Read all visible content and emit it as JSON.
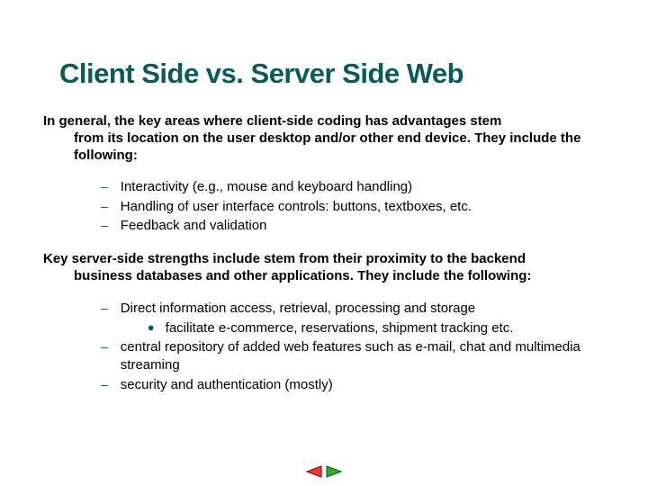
{
  "title": "Client Side vs. Server Side Web",
  "intro1_line1": "In general, the key areas where client-side coding has advantages stem",
  "intro1_rest": "from its location on the user desktop and/or other end device. They include the following:",
  "client_bullets": [
    "Interactivity (e.g., mouse and keyboard handling)",
    "Handling of user interface controls: buttons, textboxes, etc.",
    "Feedback and validation"
  ],
  "intro2_line1": "Key server-side strengths include stem from their proximity to the backend",
  "intro2_rest": "business databases and other applications. They include the following:",
  "server_bullets": [
    {
      "text": "Direct information access, retrieval, processing and storage",
      "sub": [
        "facilitate e-commerce, reservations, shipment tracking etc."
      ]
    },
    {
      "text": "central repository of added web  features such as e-mail, chat  and multimedia streaming",
      "sub": []
    },
    {
      "text": "security and authentication (mostly)",
      "sub": []
    }
  ],
  "colors": {
    "title": "#0a5a5a",
    "nav_prev_fill": "#ff3333",
    "nav_prev_stroke": "#800000",
    "nav_next_fill": "#33aa33",
    "nav_next_stroke": "#006600"
  }
}
